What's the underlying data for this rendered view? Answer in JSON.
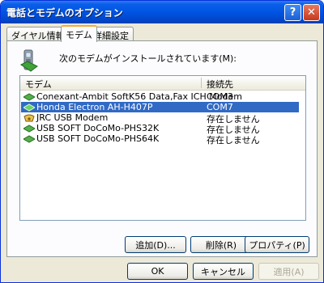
{
  "window": {
    "title": "電話とモデムのオプション",
    "help_glyph": "?",
    "close_glyph": "✕"
  },
  "tabs": [
    {
      "label": "ダイヤル情報"
    },
    {
      "label": "モデム"
    },
    {
      "label": "詳細設定"
    }
  ],
  "modems": {
    "intro": "次のモデムがインストールされています(M):",
    "columns": {
      "name": "モデム",
      "port": "接続先"
    },
    "rows": [
      {
        "name": "Conexant-Ambit SoftK56 Data,Fax ICH Modem",
        "port": "COM3",
        "icon": "modem-icon"
      },
      {
        "name": "Honda Electron AH-H407P",
        "port": "COM7",
        "icon": "modem-icon",
        "selected": true
      },
      {
        "name": "JRC USB Modem",
        "port": "存在しません",
        "icon": "phone-icon"
      },
      {
        "name": "USB SOFT DoCoMo-PHS32K",
        "port": "存在しません",
        "icon": "modem-icon"
      },
      {
        "name": "USB SOFT DoCoMo-PHS64K",
        "port": "存在しません",
        "icon": "modem-icon"
      }
    ],
    "buttons": {
      "add": "追加(D)...",
      "remove": "削除(R)",
      "properties": "プロパティ(P)"
    }
  },
  "dialog_buttons": {
    "ok": "OK",
    "cancel": "キャンセル",
    "apply": "適用(A)"
  }
}
